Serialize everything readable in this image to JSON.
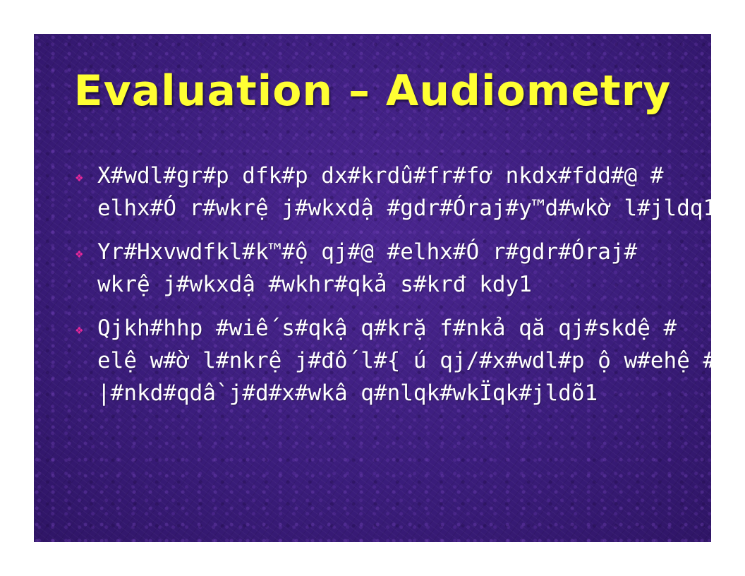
{
  "slide": {
    "title": "Evaluation – Audiometry",
    "bullet_icon": "four-diamond-bullet-icon",
    "colors": {
      "title": "#ffff33",
      "text": "#ffffff",
      "bullet": "#e8289a",
      "background": "#3a1c78"
    },
    "bullets": [
      {
        "lines": [
          "X#wdl#gr#p dfk#p dx#krdû#fr#fơ nkdx#fdd#@ #",
          "elhx#Ó r#wkrệ j#wkxdậ #gdr#Óraj#y™d#wkờ l#jldq1"
        ]
      },
      {
        "lines": [
          "Yr#Hxvwdfkl#k™#ộ qj#@ #elhx#Ó r#gdr#Óraj#",
          "wkrệ j#wkxdậ #wkhr#qkả s#krđ kdy1"
        ]
      },
      {
        "lines": [
          "Qjkh#hhp #wiế s#qkậ q#krặ f#nkả qă qj#skdệ #",
          "elệ w#ờ l#nkrệ j#đố l#{ ú qj/#x#wdl#p ộ w#ehệ #@ #jợ l#",
          "|#nkd#qdầ j#d#x#wkâ q#nlqk#wkÏqk#jldõ1"
        ]
      }
    ]
  }
}
